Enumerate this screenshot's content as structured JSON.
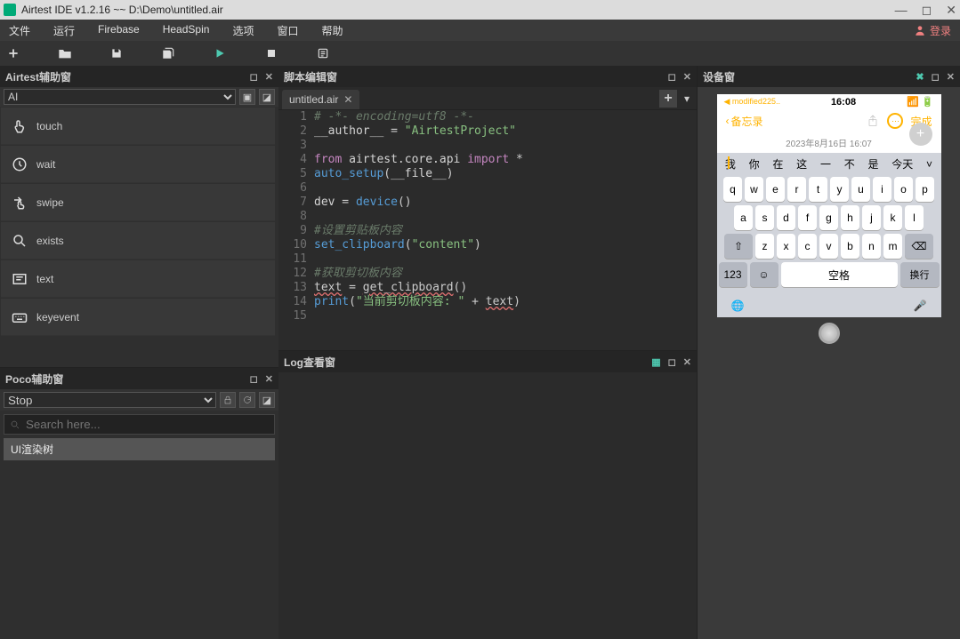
{
  "window": {
    "title": "Airtest IDE v1.2.16 ~~ D:\\Demo\\untitled.air"
  },
  "menu": {
    "file": "文件",
    "run": "运行",
    "firebase": "Firebase",
    "headspin": "HeadSpin",
    "options": "选项",
    "window": "窗口",
    "help": "帮助",
    "login": "登录"
  },
  "airtest_panel": {
    "title": "Airtest辅助窗",
    "selected": "AI",
    "items": [
      {
        "name": "touch",
        "label": "touch"
      },
      {
        "name": "wait",
        "label": "wait"
      },
      {
        "name": "swipe",
        "label": "swipe"
      },
      {
        "name": "exists",
        "label": "exists"
      },
      {
        "name": "text",
        "label": "text"
      },
      {
        "name": "keyevent",
        "label": "keyevent"
      }
    ]
  },
  "poco_panel": {
    "title": "Poco辅助窗",
    "selected": "Stop",
    "search_placeholder": "Search here...",
    "tree_root": "UI渲染树"
  },
  "editor": {
    "title": "脚本编辑窗",
    "tab": "untitled.air",
    "code": [
      {
        "n": 1,
        "t": "comment",
        "s": "# -*- encoding=utf8 -*-"
      },
      {
        "n": 2,
        "t": "assign",
        "lhs": "__author__",
        "rhs": "\"AirtestProject\""
      },
      {
        "n": 3,
        "t": "blank"
      },
      {
        "n": 4,
        "t": "import",
        "s1": "from",
        "mod": "airtest.core.api",
        "s2": "import",
        "what": "*"
      },
      {
        "n": 5,
        "t": "call",
        "fn": "auto_setup",
        "args": "__file__"
      },
      {
        "n": 6,
        "t": "blank"
      },
      {
        "n": 7,
        "t": "devassign",
        "lhs": "dev",
        "fn": "device",
        "args": ""
      },
      {
        "n": 8,
        "t": "blank"
      },
      {
        "n": 9,
        "t": "comment",
        "s": "#设置剪贴板内容"
      },
      {
        "n": 10,
        "t": "call",
        "fn": "set_clipboard",
        "args": "\"content\""
      },
      {
        "n": 11,
        "t": "blank"
      },
      {
        "n": 12,
        "t": "comment",
        "s": "#获取剪切板内容"
      },
      {
        "n": 13,
        "t": "errassign",
        "lhs": "text",
        "fn": "get_clipboard",
        "args": ""
      },
      {
        "n": 14,
        "t": "print",
        "fn": "print",
        "pre": "\"当前剪切板内容: \"",
        "plus": " + ",
        "var": "text"
      },
      {
        "n": 15,
        "t": "blank"
      }
    ]
  },
  "log_panel": {
    "title": "Log查看窗"
  },
  "device_panel": {
    "title": "设备窗",
    "phone": {
      "time": "16:08",
      "sub": "◀ modified225..",
      "back": "备忘录",
      "done": "完成",
      "date": "2023年8月16日 16:07",
      "candidates": [
        "我",
        "你",
        "在",
        "这",
        "一",
        "不",
        "是",
        "今天"
      ],
      "rows": [
        [
          "q",
          "w",
          "e",
          "r",
          "t",
          "y",
          "u",
          "i",
          "o",
          "p"
        ],
        [
          "a",
          "s",
          "d",
          "f",
          "g",
          "h",
          "j",
          "k",
          "l"
        ],
        [
          "z",
          "x",
          "c",
          "v",
          "b",
          "n",
          "m"
        ]
      ],
      "fn": {
        "num": "123",
        "space": "空格",
        "ret": "换行"
      }
    }
  }
}
